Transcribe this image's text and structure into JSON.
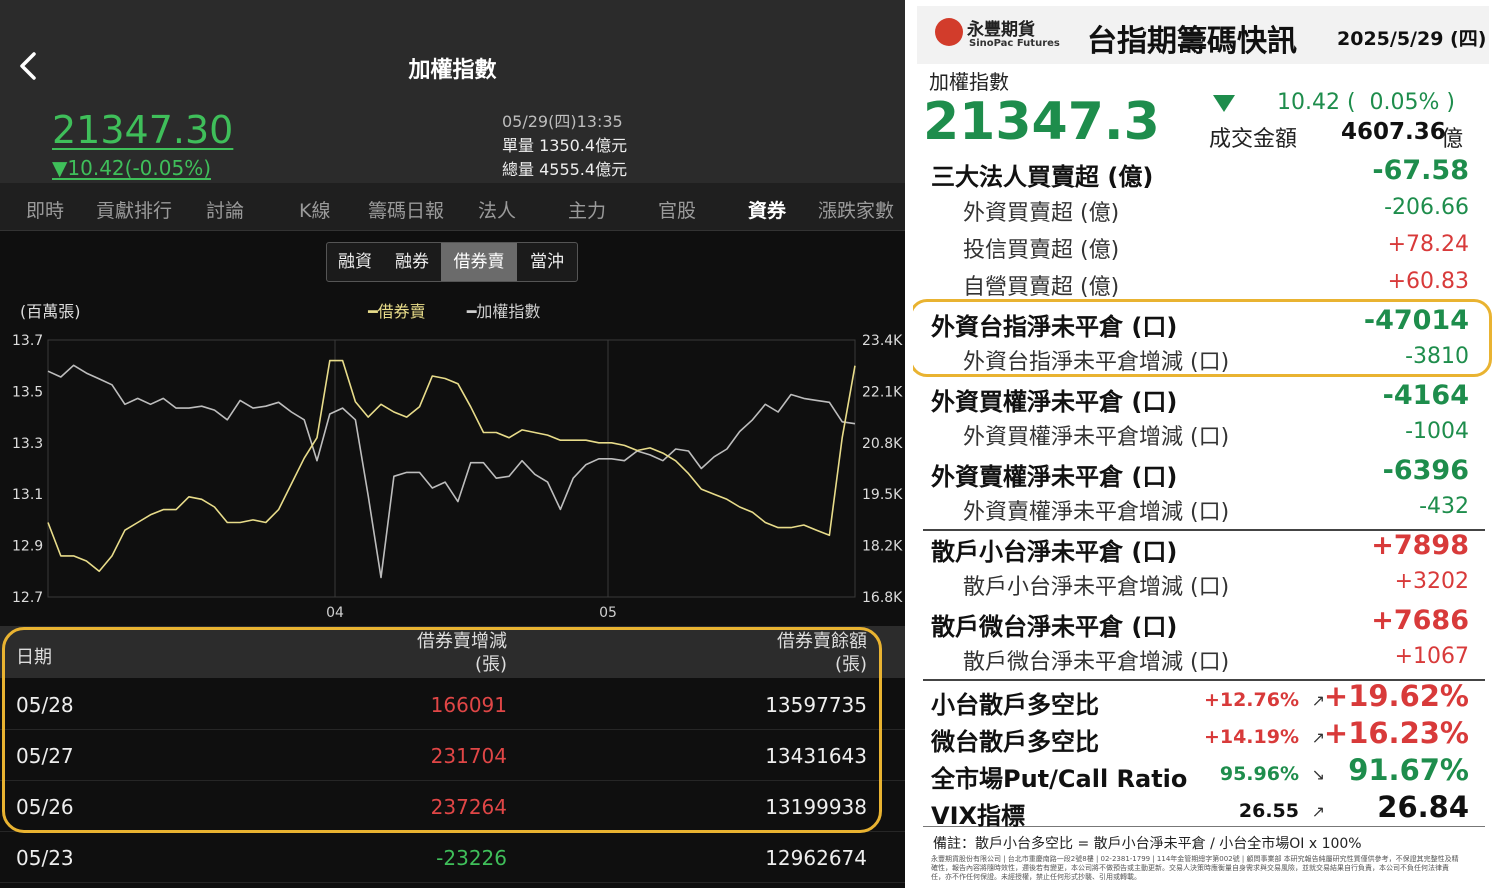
{
  "app": {
    "title": "加權指數",
    "price": "21347.30",
    "change": "▼10.42(-0.05%)",
    "datetime": "05/29(四)13:35",
    "single_vol": "單量 1350.4億元",
    "total_vol": "總量 4555.4億元",
    "tabs": [
      "即時",
      "貢獻排行",
      "討論",
      "K線",
      "籌碼日報",
      "法人",
      "主力",
      "官股",
      "資券",
      "漲跌家數"
    ],
    "active_tab": "資券",
    "segments": [
      "融資",
      "融券",
      "借券賣",
      "當沖"
    ],
    "active_segment": "借券賣",
    "colors": {
      "green": "#3fbf5a",
      "red": "#e04646",
      "series_yellow": "#e8dc8a",
      "series_gray": "#bdbdbd",
      "highlight": "#e9b331"
    }
  },
  "chart_data": {
    "type": "line",
    "unit_label": "(百萬張)",
    "legend": [
      "借券賣",
      "加權指數"
    ],
    "ylim_left": [
      12.7,
      13.7
    ],
    "left_ticks": [
      "13.7",
      "13.5",
      "13.3",
      "13.1",
      "12.9",
      "12.7"
    ],
    "ylim_right": [
      16800,
      23400
    ],
    "right_ticks": [
      "23.4K",
      "22.1K",
      "20.8K",
      "19.5K",
      "18.2K",
      "16.8K"
    ],
    "x_ticks": [
      "04",
      "05"
    ],
    "series": [
      {
        "name": "借券賣",
        "values": [
          12.99,
          12.86,
          12.86,
          12.84,
          12.8,
          12.86,
          12.96,
          12.99,
          13.02,
          13.04,
          13.04,
          13.09,
          13.08,
          13.05,
          12.99,
          12.99,
          13.0,
          12.99,
          13.04,
          13.14,
          13.24,
          13.32,
          13.62,
          13.62,
          13.46,
          13.4,
          13.45,
          13.42,
          13.4,
          13.44,
          13.56,
          13.55,
          13.53,
          13.44,
          13.34,
          13.34,
          13.32,
          13.35,
          13.34,
          13.33,
          13.31,
          13.31,
          13.31,
          13.3,
          13.3,
          13.29,
          13.27,
          13.28,
          13.26,
          13.23,
          13.18,
          13.12,
          13.1,
          13.08,
          13.05,
          13.03,
          12.99,
          12.97,
          12.97,
          12.98,
          12.96,
          12.94,
          13.32,
          13.6
        ]
      },
      {
        "name": "加權指數",
        "values": [
          22600,
          22450,
          22750,
          22550,
          22400,
          22250,
          21750,
          21900,
          21750,
          21900,
          21650,
          21650,
          21700,
          21600,
          21350,
          21850,
          21650,
          21700,
          21800,
          21550,
          21350,
          20300,
          21500,
          21650,
          21350,
          19400,
          17300,
          19900,
          20000,
          20000,
          19600,
          19750,
          19250,
          20250,
          20250,
          19850,
          19900,
          20300,
          19950,
          19750,
          19050,
          19850,
          20200,
          20350,
          20350,
          20300,
          20550,
          20450,
          20300,
          20600,
          20550,
          20100,
          20400,
          20600,
          21050,
          21350,
          21750,
          21550,
          22000,
          21900,
          21850,
          21800,
          21300,
          21250
        ]
      }
    ]
  },
  "table": {
    "headers": {
      "date": "日期",
      "change_l1": "借券賣增減",
      "change_l2": "(張)",
      "balance_l1": "借券賣餘額",
      "balance_l2": "(張)"
    },
    "rows": [
      {
        "date": "05/28",
        "change": "166091",
        "balance": "13597735",
        "dir": "up"
      },
      {
        "date": "05/27",
        "change": "231704",
        "balance": "13431643",
        "dir": "up"
      },
      {
        "date": "05/26",
        "change": "237264",
        "balance": "13199938",
        "dir": "up"
      },
      {
        "date": "05/23",
        "change": "-23226",
        "balance": "12962674",
        "dir": "dn"
      }
    ]
  },
  "report": {
    "logo_text": "永豐期貨",
    "logo_sub": "SinoPac Futures",
    "title": "台指期籌碼快訊",
    "date": "2025/5/29 (四)",
    "index_name": "加權指數",
    "index_value": "21347.3",
    "index_change": "10.42 (  0.05% )",
    "volume_label": "成交金額",
    "volume_value": "4607.36",
    "volume_unit": "億",
    "lines": [
      {
        "label": "三大法人買賣超 (億)",
        "value": "-67.58",
        "style": "b",
        "color": "g"
      },
      {
        "label": "外資買賣超 (億)",
        "value": "-206.66",
        "style": "s",
        "color": "g"
      },
      {
        "label": "投信買賣超 (億)",
        "value": "+78.24",
        "style": "s",
        "color": "r"
      },
      {
        "label": "自營買賣超 (億)",
        "value": "+60.83",
        "style": "s",
        "color": "r"
      },
      {
        "label": "外資台指淨未平倉 (口)",
        "value": "-47014",
        "style": "b",
        "color": "g"
      },
      {
        "label": "外資台指淨未平倉增減 (口)",
        "value": "-3810",
        "style": "s",
        "color": "g"
      },
      {
        "label": "外資買權淨未平倉 (口)",
        "value": "-4164",
        "style": "b",
        "color": "g"
      },
      {
        "label": "外資買權淨未平倉增減 (口)",
        "value": "-1004",
        "style": "s",
        "color": "g"
      },
      {
        "label": "外資賣權淨未平倉 (口)",
        "value": "-6396",
        "style": "b",
        "color": "g"
      },
      {
        "label": "外資賣權淨未平倉增減 (口)",
        "value": "-432",
        "style": "s",
        "color": "g"
      },
      {
        "label": "散戶小台淨未平倉 (口)",
        "value": "+7898",
        "style": "b",
        "color": "r"
      },
      {
        "label": "散戶小台淨未平倉增減 (口)",
        "value": "+3202",
        "style": "s",
        "color": "r"
      },
      {
        "label": "散戶微台淨未平倉 (口)",
        "value": "+7686",
        "style": "b",
        "color": "r"
      },
      {
        "label": "散戶微台淨未平倉增減 (口)",
        "value": "+1067",
        "style": "s",
        "color": "r"
      }
    ],
    "ratios": [
      {
        "label": "小台散戶多空比",
        "prev": "+12.76%",
        "arrow": "↗",
        "value": "+19.62%",
        "pcolor": "r",
        "vcolor": "r"
      },
      {
        "label": "微台散戶多空比",
        "prev": "+14.19%",
        "arrow": "↗",
        "value": "+16.23%",
        "pcolor": "r",
        "vcolor": "r"
      },
      {
        "label": "全市場Put/Call Ratio",
        "prev": "95.96%",
        "arrow": "↘",
        "value": "91.67%",
        "pcolor": "g",
        "vcolor": "g"
      },
      {
        "label": "VIX指標",
        "prev": "26.55",
        "arrow": "↗",
        "value": "26.84",
        "pcolor": "k",
        "vcolor": "k"
      }
    ],
    "note": "備註：散戶小台多空比 = 散戶小台淨未平倉 / 小台全市場OI x 100%",
    "fine_print": "永豐期貨股份有限公司 | 台北市重慶南路一段2號8樓 | 02-2381-1799 | 114年金管期總字第002號 | 顧問事業部 本研究報告純屬研究性質僅供參考，不保證其完整性及精確性，報告內容將隨時效性，邇後若有變更，本公司將不做預告或主動更新。交易人決策時應衡量自身需求與交易風險，並就交易結果自行負責，本公司不負任何法律責任，亦不作任何保證。未經授權，禁止任何形式抄襲、引用或轉載。"
  }
}
